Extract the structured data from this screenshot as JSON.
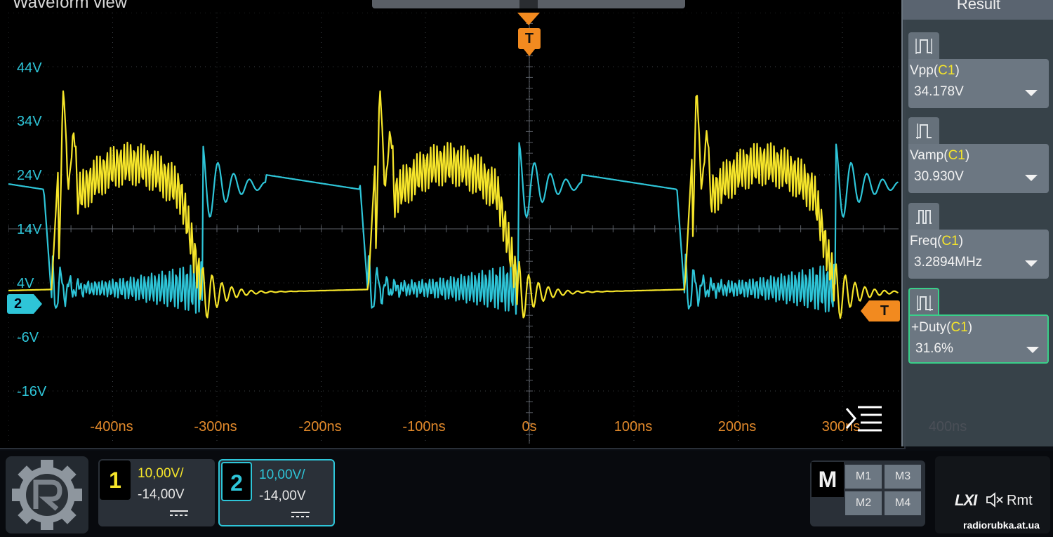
{
  "window": {
    "title": "Waveform view"
  },
  "colors": {
    "ch1": "#f6e52a",
    "ch2": "#2ec5d8",
    "trigger": "#f28a1f",
    "time_axis": "#e38a2b",
    "panel_selected": "#39d08a"
  },
  "y_axis": {
    "labels": [
      "44V",
      "34V",
      "24V",
      "14V",
      "4V",
      "-6V",
      "-16V"
    ]
  },
  "x_axis": {
    "labels": [
      "-400ns",
      "-300ns",
      "-200ns",
      "-100ns",
      "0s",
      "100ns",
      "200ns",
      "300ns",
      "400ns"
    ]
  },
  "markers": {
    "trigger_time": "T",
    "channel2": "2",
    "trigger_level": "T"
  },
  "result_panel": {
    "title": "Result",
    "measurements": [
      {
        "name": "Vpp",
        "source": "C1",
        "value": "34.178V",
        "icon": "pulse-icon",
        "selected": false
      },
      {
        "name": "Vamp",
        "source": "C1",
        "value": "30.930V",
        "icon": "pulse-icon",
        "selected": false
      },
      {
        "name": "Freq",
        "source": "C1",
        "value": "3.2894MHz",
        "icon": "period-icon",
        "selected": false
      },
      {
        "name": "+Duty",
        "source": "C1",
        "value": "31.6%",
        "icon": "duty-icon",
        "selected": true
      }
    ]
  },
  "channels": [
    {
      "number": "1",
      "scale": "10,00V/",
      "offset": "-14,00V",
      "coupling": "dc-coupling-icon"
    },
    {
      "number": "2",
      "scale": "10,00V/",
      "offset": "-14,00V",
      "coupling": "dc-coupling-icon"
    }
  ],
  "math": {
    "label": "M",
    "buttons": [
      "M1",
      "M3",
      "M2",
      "M4"
    ]
  },
  "status": {
    "lxi": "LXI",
    "remote": "Rmt",
    "speaker_icon": "speaker-muted-icon"
  },
  "watermark": "radiorubka.at.ua"
}
